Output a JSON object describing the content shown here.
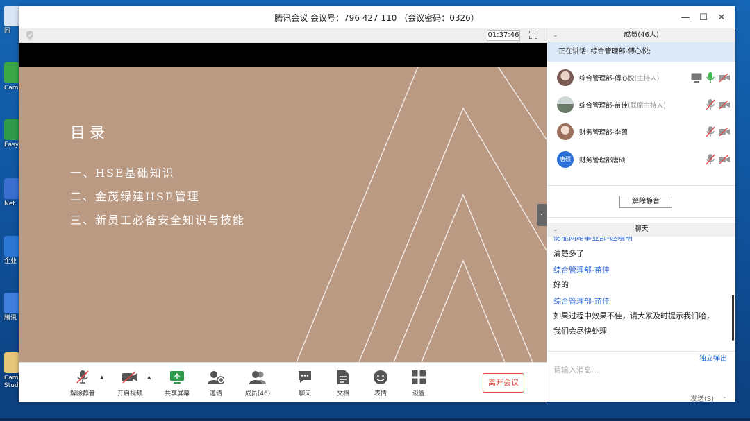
{
  "window": {
    "title": "腾讯会议 会议号：796 427 110 （会议密码：0326）",
    "minimize": "—",
    "maximize": "☐",
    "close": "✕"
  },
  "desktop": {
    "icons": [
      {
        "label": "回",
        "color": "#d9e6f5"
      },
      {
        "label": "Camt",
        "color": "#3aa845"
      },
      {
        "label": "EasyC",
        "color": "#2f9a4a"
      },
      {
        "label": "Net",
        "color": "#3b6fcf"
      },
      {
        "label": "企业",
        "color": "#2c77d4"
      },
      {
        "label": "腾讯",
        "color": "#3f7edc"
      },
      {
        "label": "Cam Studi",
        "color": "#e7c77a"
      }
    ]
  },
  "video": {
    "timer": "01:37:46",
    "slide": {
      "title": "目录",
      "items": [
        "一、HSE基础知识",
        "二、金茂绿建HSE管理",
        "三、新员工必备安全知识与技能"
      ]
    },
    "collapse_icon": "‹"
  },
  "toolbar": {
    "unmute_label": "解除静音",
    "video_label": "开启视频",
    "share_label": "共享屏幕",
    "invite_label": "邀请",
    "members_label": "成员(46)",
    "chat_label": "聊天",
    "docs_label": "文档",
    "emoji_label": "表情",
    "settings_label": "设置",
    "leave_label": "离开会议",
    "caret": "▲"
  },
  "members_panel": {
    "header": "成员(46人)",
    "speaking": "正在讲话: 综合管理部-傅心悦;",
    "members": [
      {
        "name": "综合管理部-傅心悦",
        "role": "(主持人)",
        "avatar_color": "#7a5a52"
      },
      {
        "name": "综合管理部-苗佳",
        "role": "(联席主持人)",
        "avatar_color": "#6b7b6a"
      },
      {
        "name": "财务管理部-李蕴",
        "role": "",
        "avatar_color": "#9a6f5b"
      },
      {
        "name": "财务管理部唐硕",
        "role": "",
        "avatar_text": "唐硕",
        "avatar_color": "#2b6fd9"
      }
    ],
    "unmute_all": "解除静音"
  },
  "chat_panel": {
    "header": "聊天",
    "messages": [
      {
        "kind": "sender",
        "text": "储能网络事业部-赵晓萌"
      },
      {
        "kind": "text",
        "text": "清楚多了"
      },
      {
        "kind": "sender",
        "text": "综合管理部-苗佳"
      },
      {
        "kind": "text",
        "text": "好的"
      },
      {
        "kind": "sender",
        "text": "综合管理部-苗佳"
      },
      {
        "kind": "text",
        "text": "如果过程中效果不佳，请大家及时提示我们哈，"
      },
      {
        "kind": "text",
        "text": "我们会尽快处理"
      }
    ],
    "popout": "独立弹出",
    "input_placeholder": "请输入消息...",
    "send": "发送(S)",
    "send_caret": "⌄"
  },
  "colors": {
    "slide_bg": "#bb9a84",
    "accent_blue": "#2a6dd9",
    "leave_red": "#e6453a",
    "mic_green": "#3cb54a",
    "muted_red": "#e24a4a"
  }
}
